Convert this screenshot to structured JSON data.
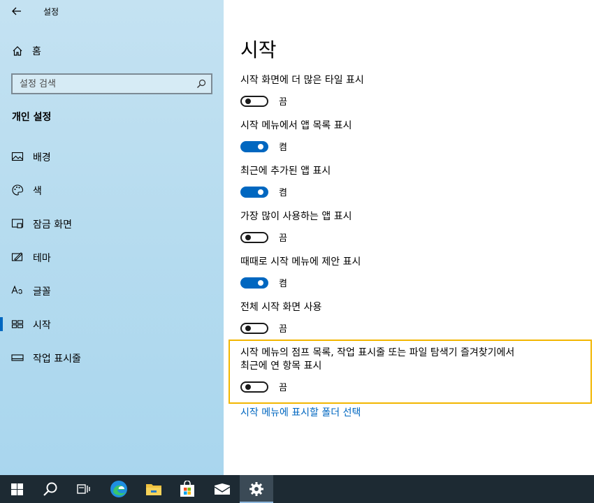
{
  "window": {
    "title": "설정"
  },
  "nav": {
    "home_label": "홈",
    "search_placeholder": "설정 검색",
    "section_heading": "개인 설정",
    "items": [
      {
        "label": "배경",
        "icon": "picture-icon",
        "active": false
      },
      {
        "label": "색",
        "icon": "palette-icon",
        "active": false
      },
      {
        "label": "잠금 화면",
        "icon": "lock-screen-icon",
        "active": false
      },
      {
        "label": "테마",
        "icon": "theme-icon",
        "active": false
      },
      {
        "label": "글꼴",
        "icon": "font-icon",
        "active": false
      },
      {
        "label": "시작",
        "icon": "start-icon",
        "active": true
      },
      {
        "label": "작업 표시줄",
        "icon": "taskbar-icon",
        "active": false
      }
    ]
  },
  "main": {
    "title": "시작",
    "settings": [
      {
        "label": "시작 화면에 더 많은 타일 표시",
        "state": "끔",
        "on": false
      },
      {
        "label": "시작 메뉴에서 앱 목록 표시",
        "state": "켬",
        "on": true
      },
      {
        "label": "최근에 추가된 앱 표시",
        "state": "켬",
        "on": true
      },
      {
        "label": "가장 많이 사용하는 앱 표시",
        "state": "끔",
        "on": false
      },
      {
        "label": "때때로 시작 메뉴에 제안 표시",
        "state": "켬",
        "on": true
      },
      {
        "label": "전체 시작 화면 사용",
        "state": "끔",
        "on": false
      },
      {
        "label_line1": "시작 메뉴의 점프 목록, 작업 표시줄 또는 파일 탐색기 즐겨찾기에서",
        "label_line2": "최근에 연 항목 표시",
        "state": "끔",
        "on": false
      }
    ],
    "link": "시작 메뉴에 표시할 폴더 선택"
  },
  "taskbar": {
    "items": [
      "windows-start-icon",
      "search-icon",
      "task-view-icon",
      "edge-icon",
      "file-explorer-icon",
      "store-icon",
      "mail-icon",
      "settings-gear-icon"
    ],
    "active": "settings-gear-icon"
  },
  "colors": {
    "accent": "#0067c0",
    "highlight": "#f2b600",
    "taskbar": "#1d2a33"
  }
}
